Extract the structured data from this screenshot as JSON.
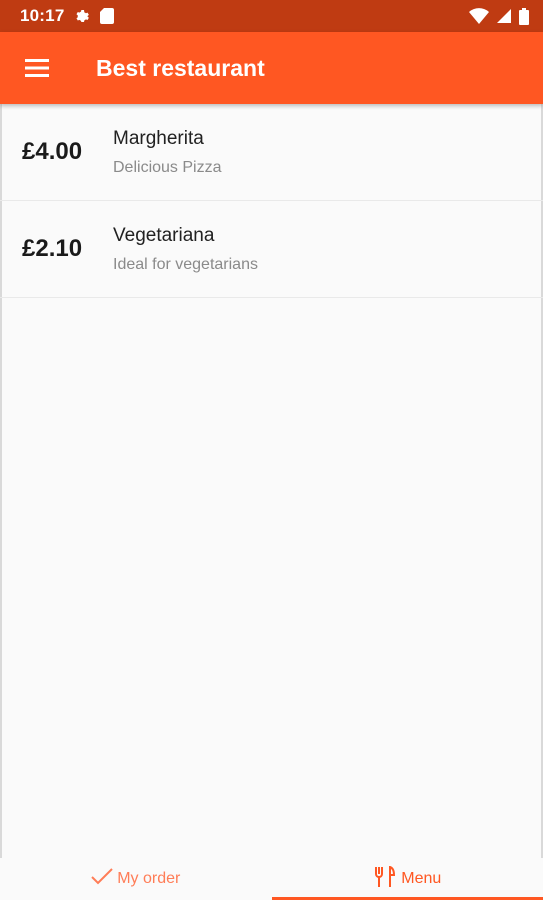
{
  "status_bar": {
    "time": "10:17",
    "icons": [
      "settings-icon",
      "sd-card-icon",
      "wifi-icon",
      "signal-icon",
      "battery-icon"
    ]
  },
  "app_bar": {
    "title": "Best restaurant",
    "menu_icon": "hamburger-menu-icon",
    "color": "#ff5722"
  },
  "menu_items": [
    {
      "price": "£4.00",
      "name": "Margherita",
      "description": "Delicious Pizza"
    },
    {
      "price": "£2.10",
      "name": "Vegetariana",
      "description": "Ideal for vegetarians"
    }
  ],
  "bottom_nav": {
    "tabs": [
      {
        "label": "My order",
        "icon": "check-icon",
        "selected": false
      },
      {
        "label": "Menu",
        "icon": "restaurant-icon",
        "selected": true
      }
    ]
  },
  "colors": {
    "accent": "#ff5722",
    "status_bar": "#bf3b12"
  }
}
